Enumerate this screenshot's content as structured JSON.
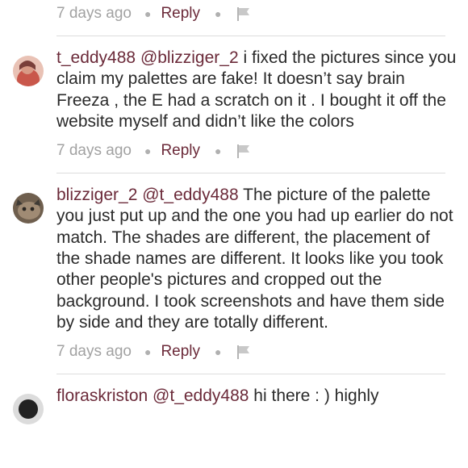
{
  "comments": [
    {
      "time": "7 days ago",
      "reply_label": "Reply"
    },
    {
      "username": "t_eddy488",
      "mention": "@blizziger_2",
      "text": " i fixed the pictures since you claim my palettes are fake! It doesn’t say brain Freeza , the E had a scratch on it . I bought it off the website myself and didn’t like the colors",
      "time": "7 days ago",
      "reply_label": "Reply",
      "avatar_colors": [
        "#e8b6a8",
        "#c4584e"
      ]
    },
    {
      "username": "blizziger_2",
      "mention": "@t_eddy488",
      "text": " The picture of the palette you just put up and the one you had up earlier do not match. The shades are different, the placement of the shade names are different. It looks like you took other people's pictures and cropped out the background. I took screenshots and have them side by side and they are totally different.",
      "time": "7 days ago",
      "reply_label": "Reply",
      "avatar_colors": [
        "#8a7560",
        "#3e3a35"
      ]
    },
    {
      "username": "floraskriston",
      "mention": "@t_eddy488",
      "text": " hi there : ) highly",
      "avatar_colors": [
        "#222222",
        "#777777"
      ]
    }
  ],
  "colors": {
    "accent": "#6b2a39",
    "meta_gray": "#a2a2a2",
    "divider": "#dddddd"
  },
  "icons": [
    "flag-icon"
  ]
}
